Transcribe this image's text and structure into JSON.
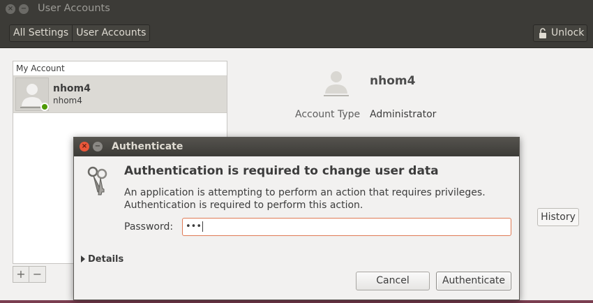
{
  "window": {
    "title": "User Accounts"
  },
  "toolbar": {
    "breadcrumbs": [
      "All Settings",
      "User Accounts"
    ],
    "unlock_label": "Unlock"
  },
  "user_list": {
    "header": "My Account",
    "users": [
      {
        "name": "nhom4",
        "login": "nhom4",
        "status": "online"
      }
    ]
  },
  "details": {
    "name": "nhom4",
    "account_type_label": "Account Type",
    "account_type_value": "Administrator",
    "history_label": "History"
  },
  "dialog": {
    "title": "Authenticate",
    "heading": "Authentication is required to change user data",
    "message_line1": "An application is attempting to perform an action that requires privileges.",
    "message_line2": "Authentication is required to perform this action.",
    "password_label": "Password:",
    "password_value": "•••",
    "details_label": "Details",
    "cancel_label": "Cancel",
    "authenticate_label": "Authenticate"
  },
  "colors": {
    "titlebar": "#3c3b37",
    "close_button": "#e9573a",
    "focus_border": "#e07a55",
    "online": "#4e9a06"
  }
}
